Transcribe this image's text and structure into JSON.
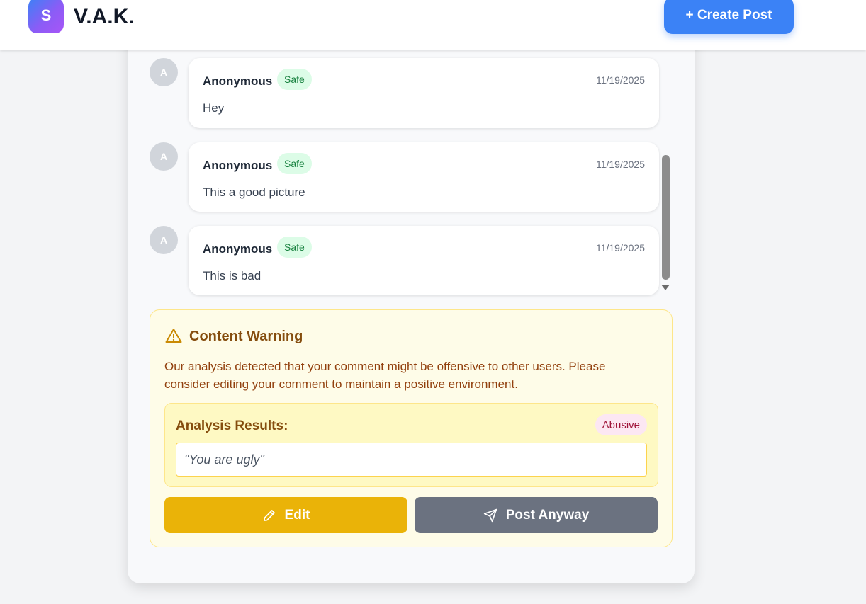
{
  "header": {
    "logo_letter": "S",
    "brand": "V.A.K.",
    "create_post_label": "+ Create Post"
  },
  "comments": [
    {
      "avatar_letter": "A",
      "author": "Anonymous",
      "badge": "Safe",
      "date": "11/19/2025",
      "text": "Hey"
    },
    {
      "avatar_letter": "A",
      "author": "Anonymous",
      "badge": "Safe",
      "date": "11/19/2025",
      "text": "This a good picture"
    },
    {
      "avatar_letter": "A",
      "author": "Anonymous",
      "badge": "Safe",
      "date": "11/19/2025",
      "text": "This is bad"
    }
  ],
  "warning": {
    "title": "Content Warning",
    "message": "Our analysis detected that your comment might be offensive to other users. Please consider editing your comment to maintain a positive environment.",
    "analysis_label": "Analysis Results:",
    "analysis_badge": "Abusive",
    "quote": "\"You are ugly\"",
    "edit_label": "Edit",
    "post_anyway_label": "Post Anyway"
  },
  "icons": {
    "warning": "warning-triangle-icon",
    "edit": "pencil-icon",
    "post": "send-icon"
  },
  "colors": {
    "accent": "#3b82f6",
    "safe_bg": "#dcfce7",
    "safe_text": "#15803d",
    "warning_bg": "#fefce8",
    "abusive_bg": "#fce7f3",
    "edit_button": "#eab308",
    "post_button": "#6b7280"
  }
}
